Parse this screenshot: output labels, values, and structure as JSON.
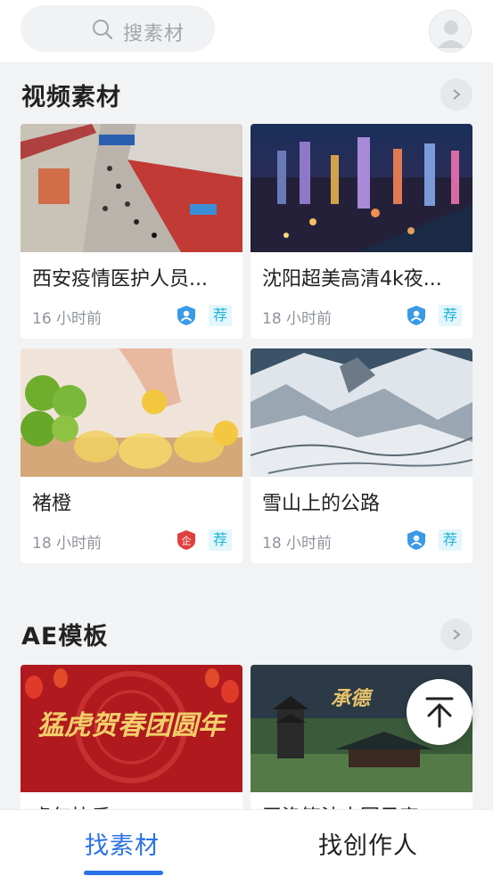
{
  "header": {
    "search_placeholder": "搜素材",
    "icons": {
      "search": "search-icon",
      "avatar": "user-avatar-icon"
    }
  },
  "sections": [
    {
      "title": "视频素材",
      "cards": [
        {
          "title": "西安疫情医护人员...",
          "time": "16 小时前",
          "badge": "verified-person-icon",
          "rec": "荐"
        },
        {
          "title": "沈阳超美高清4k夜...",
          "time": "18 小时前",
          "badge": "verified-person-icon",
          "rec": "荐"
        },
        {
          "title": "褚橙",
          "time": "18 小时前",
          "badge": "enterprise-badge-icon",
          "badge_label": "企",
          "rec": "荐"
        },
        {
          "title": "雪山上的公路",
          "time": "18 小时前",
          "badge": "verified-person-icon",
          "rec": "荐"
        }
      ]
    },
    {
      "title": "AE模板",
      "cards": [
        {
          "title": "虎年快乐",
          "thumb_text": "猛虎贺春团圆年"
        },
        {
          "title": "王洛笙法中国风宣"
        }
      ]
    }
  ],
  "tabbar": {
    "tabs": [
      {
        "label": "找素材",
        "active": true
      },
      {
        "label": "找创作人",
        "active": false
      }
    ]
  },
  "colors": {
    "accent": "#2a72e8",
    "recommend": "#1db3d6",
    "verified": "#3a9ae8",
    "enterprise": "#e04040"
  }
}
